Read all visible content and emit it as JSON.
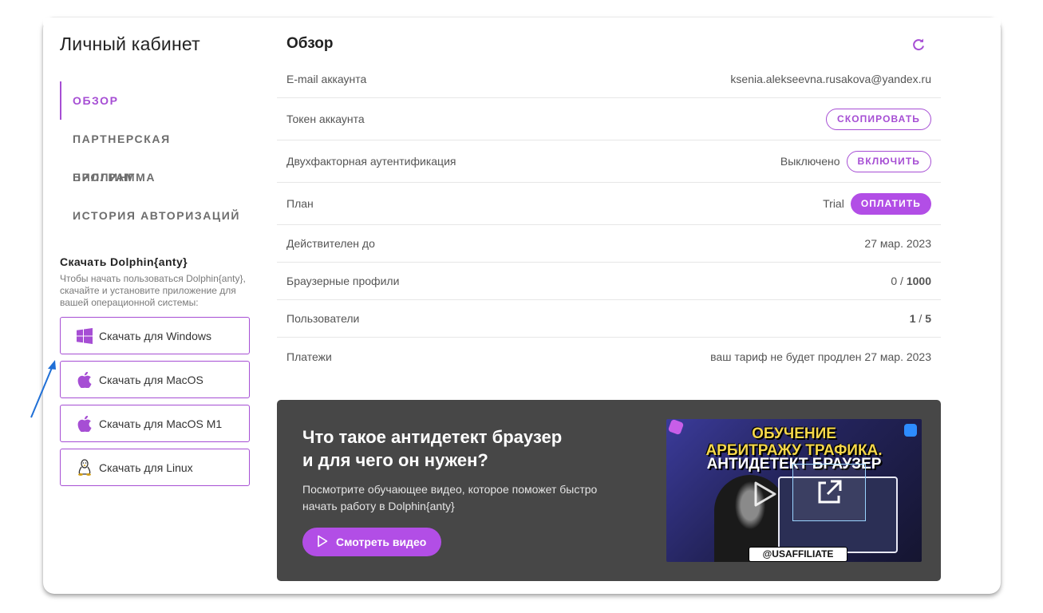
{
  "page": {
    "title": "Личный кабинет"
  },
  "nav": {
    "items": [
      {
        "label": "ОБЗОР",
        "active": true
      },
      {
        "label": "ПАРТНЕРСКАЯ ПРОГРАММА",
        "active": false
      },
      {
        "label": "БИЛЛИНГ",
        "active": false
      },
      {
        "label": "ИСТОРИЯ АВТОРИЗАЦИЙ",
        "active": false
      }
    ]
  },
  "download": {
    "title": "Скачать Dolphin{anty}",
    "description": "Чтобы начать пользоваться Dolphin{anty}, скачайте и установите приложение для вашей операционной системы:",
    "buttons": [
      {
        "label": "Скачать для Windows",
        "icon": "windows-icon"
      },
      {
        "label": "Скачать для MacOS",
        "icon": "apple-icon"
      },
      {
        "label": "Скачать для MacOS M1",
        "icon": "apple-icon"
      },
      {
        "label": "Скачать для Linux",
        "icon": "linux-icon"
      }
    ]
  },
  "overview": {
    "title": "Обзор",
    "refresh_icon": "refresh-icon",
    "rows": {
      "email": {
        "label": "E-mail аккаунта",
        "value": "ksenia.alekseevna.rusakova@yandex.ru"
      },
      "token": {
        "label": "Токен аккаунта",
        "button": "СКОПИРОВАТЬ"
      },
      "twofa": {
        "label": "Двухфакторная аутентификация",
        "status": "Выключено",
        "button": "ВКЛЮЧИТЬ"
      },
      "plan": {
        "label": "План",
        "value": "Trial",
        "button": "ОПЛАТИТЬ"
      },
      "valid": {
        "label": "Действителен до",
        "value": "27 мар. 2023"
      },
      "profiles": {
        "label": "Браузерные профили",
        "used": "0",
        "sep": " / ",
        "total": "1000"
      },
      "users": {
        "label": "Пользователи",
        "used": "1",
        "sep": " / ",
        "total": "5"
      },
      "payments": {
        "label": "Платежи",
        "value": "ваш тариф не будет продлен 27 мар. 2023"
      }
    }
  },
  "video": {
    "heading_line1": "Что такое антидетект браузер",
    "heading_line2": "и для чего он нужен?",
    "text": "Посмотрите обучающее видео, которое поможет быстро начать работу в Dolphin{anty}",
    "button": "Смотреть видео",
    "thumbnail": {
      "line1": "ОБУЧЕНИЕ",
      "line2": "АРБИТРАЖУ ТРАФИКА.",
      "line3": "АНТИДЕТЕКТ БРАУЗЕР",
      "badge": "@USAFFILIATE"
    }
  },
  "colors": {
    "accent": "#a64ed4",
    "accent_fill": "#b24ee6",
    "green": "#3c9a4c",
    "video_bg": "#474747",
    "arrow": "#1f6fd6"
  }
}
